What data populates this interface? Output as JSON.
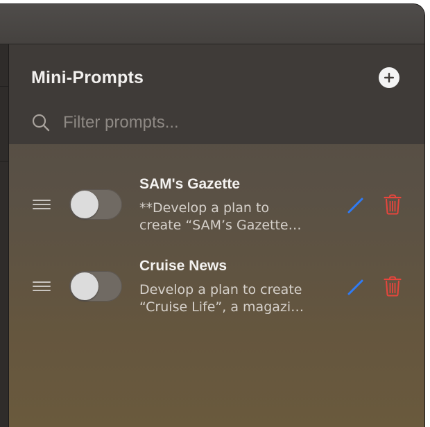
{
  "panel": {
    "title": "Mini-Prompts",
    "search_placeholder": "Filter prompts..."
  },
  "prompts": [
    {
      "title": "SAM's Gazette",
      "description": "**Develop a plan to\ncreate “SAM’s Gazette…",
      "enabled": false
    },
    {
      "title": "Cruise News",
      "description": "Develop a plan to create\n“Cruise Life”, a magazi…",
      "enabled": false
    }
  ],
  "icons": {
    "add": "plus-circle-icon",
    "search": "search-icon",
    "drag": "drag-handle-icon",
    "edit": "pencil-icon",
    "delete": "trash-icon"
  },
  "colors": {
    "edit_icon": "#2f7bf5",
    "delete_icon": "#e8453c"
  }
}
